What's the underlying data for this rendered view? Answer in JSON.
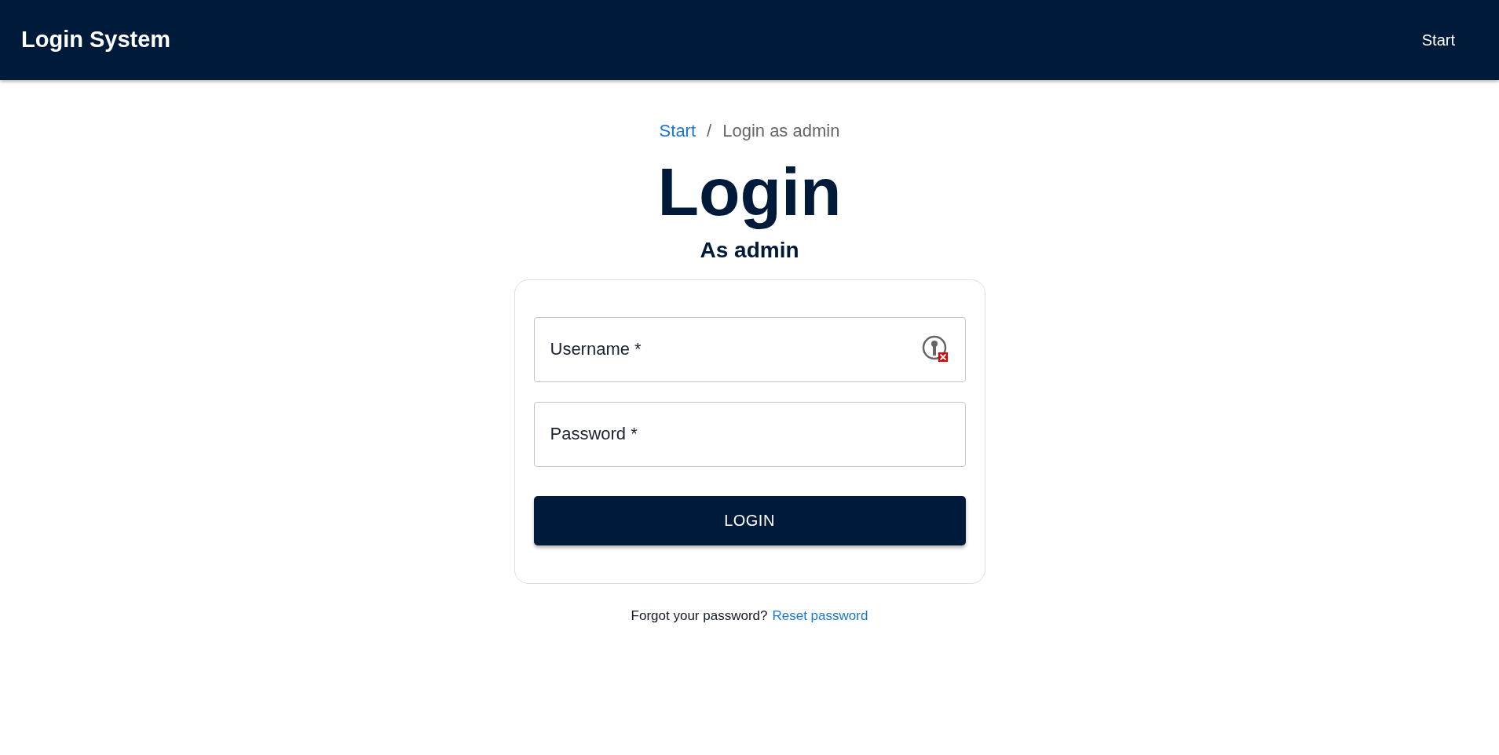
{
  "header": {
    "title": "Login System",
    "nav": [
      "Start"
    ]
  },
  "breadcrumb": [
    {
      "label": "Start",
      "kind": "link"
    },
    {
      "label": "/",
      "kind": "separator"
    },
    {
      "label": "Login as admin",
      "kind": "current"
    }
  ],
  "heading": "Login",
  "subheading": "As admin",
  "fields": [
    {
      "kind": "username",
      "placeholder": "Username *"
    },
    {
      "kind": "password",
      "placeholder": "Password *"
    }
  ],
  "button": "LOGIN",
  "footer": {
    "text": "Forgot your password?",
    "link": "Reset password"
  }
}
